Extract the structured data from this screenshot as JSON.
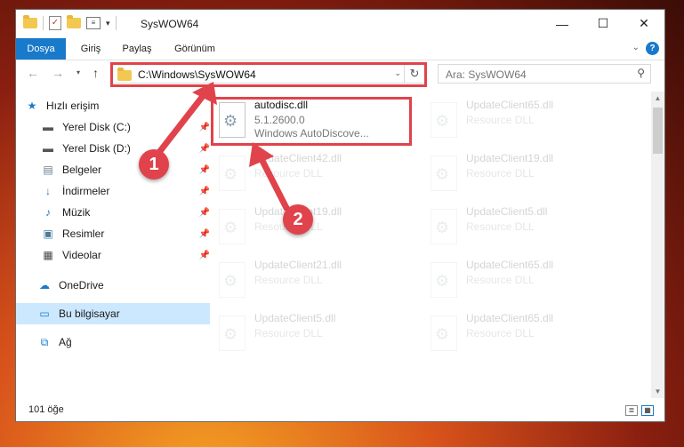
{
  "window": {
    "title": "SysWOW64"
  },
  "ribbon": {
    "tabs": [
      "Dosya",
      "Giriş",
      "Paylaş",
      "Görünüm"
    ]
  },
  "address": {
    "path": "C:\\Windows\\SysWOW64"
  },
  "search": {
    "placeholder": "Ara: SysWOW64"
  },
  "sidebar": {
    "items": [
      {
        "label": "Hızlı erişim",
        "icon": "star-icon"
      },
      {
        "label": "Yerel Disk (C:)",
        "icon": "drive-icon",
        "pinned": true
      },
      {
        "label": "Yerel Disk (D:)",
        "icon": "drive-icon",
        "pinned": true
      },
      {
        "label": "Belgeler",
        "icon": "documents-icon",
        "pinned": true
      },
      {
        "label": "İndirmeler",
        "icon": "download-icon",
        "pinned": true
      },
      {
        "label": "Müzik",
        "icon": "music-icon",
        "pinned": true
      },
      {
        "label": "Resimler",
        "icon": "pictures-icon",
        "pinned": true
      },
      {
        "label": "Videolar",
        "icon": "video-icon",
        "pinned": true
      },
      {
        "label": "OneDrive",
        "icon": "cloud-icon"
      },
      {
        "label": "Bu bilgisayar",
        "icon": "computer-icon"
      },
      {
        "label": "Ağ",
        "icon": "network-icon"
      }
    ]
  },
  "files": [
    {
      "name": "autodisc.dll",
      "version": "5.1.2600.0",
      "description": "Windows AutoDiscove..."
    },
    {
      "name": "UpdateClient65.dll",
      "description": "Resource DLL"
    },
    {
      "name": "UpdateClient42.dll",
      "description": "Resource DLL"
    },
    {
      "name": "UpdateClient19.dll",
      "description": "Resource DLL"
    },
    {
      "name": "UpdateClient19.dll",
      "description": "Resource DLL"
    },
    {
      "name": "UpdateClient5.dll",
      "description": "Resource DLL"
    },
    {
      "name": "UpdateClient21.dll",
      "description": "Resource DLL"
    },
    {
      "name": "UpdateClient65.dll",
      "description": "Resource DLL"
    },
    {
      "name": "UpdateClient5.dll",
      "description": "Resource DLL"
    },
    {
      "name": "UpdateClient65.dll",
      "description": "Resource DLL"
    }
  ],
  "status": {
    "item_count": "101 öğe"
  },
  "annotations": {
    "step1": "1",
    "step2": "2",
    "color": "#e0434b"
  }
}
